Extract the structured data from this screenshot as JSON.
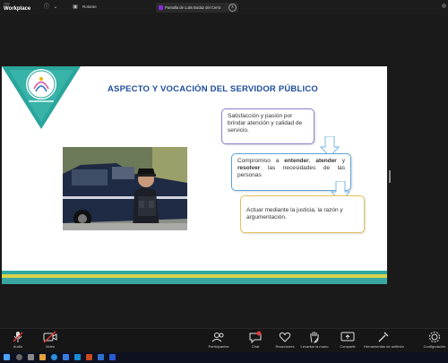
{
  "app": {
    "brand_line1": "meta",
    "brand_line2": "Workplace",
    "rotate_label": "Rotante",
    "share_label": "Pantalla de Lutis Bodaz del Cerro",
    "share_close": "x"
  },
  "slide": {
    "title": "ASPECTO  Y VOCACIÓN DEL SERVIDOR PÚBLICO",
    "box1": "Satisfacción y pasión por brindar atención y calidad de servicio.",
    "box2_parts": [
      "Compromiso a ",
      "entender",
      ", ",
      "atender",
      " y ",
      "resolver",
      " las necesidades de las personas"
    ],
    "box3": "Actuar mediante la justicia, la razón y argumentación.",
    "colors": {
      "title": "#1f4d9c",
      "teal": "#2fa8a0",
      "yellow": "#d9d24a"
    }
  },
  "toolbar": [
    {
      "label": "Audio",
      "icon": "microphone-off-icon"
    },
    {
      "label": "Video",
      "icon": "camera-off-icon"
    },
    {
      "label": "Participantes",
      "icon": "people-icon"
    },
    {
      "label": "Chat",
      "icon": "chat-icon"
    },
    {
      "label": "Reacciones",
      "icon": "heart-icon"
    },
    {
      "label": "Levantar la mano",
      "icon": "hand-icon"
    },
    {
      "label": "Compartir",
      "icon": "share-screen-icon"
    },
    {
      "label": "Herramientas de anfitrión",
      "icon": "tools-icon"
    },
    {
      "label": "Configuración",
      "icon": "gear-icon"
    }
  ]
}
